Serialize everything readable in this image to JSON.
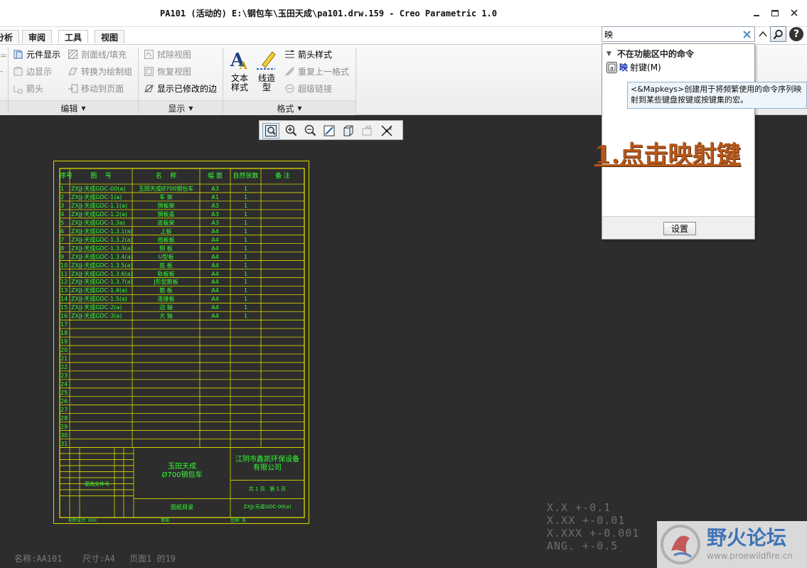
{
  "window": {
    "title": "PA101 (活动的) E:\\钢包车\\玉田天成\\pa101.drw.159 - Creo Parametric 1.0"
  },
  "tabs": [
    "分析",
    "审阅",
    "工具",
    "视图"
  ],
  "ribbon": {
    "edit_group": {
      "label": "编辑",
      "items": [
        {
          "label": "元件显示",
          "enabled": true
        },
        {
          "label": "边显示",
          "enabled": false
        },
        {
          "label": "箭头",
          "enabled": false
        },
        {
          "label": "剖面线/填充",
          "enabled": false
        },
        {
          "label": "转换为绘制组",
          "enabled": false
        },
        {
          "label": "移动到页面",
          "enabled": false
        }
      ]
    },
    "display_group": {
      "label": "显示",
      "items": [
        {
          "label": "拭除视图",
          "enabled": false
        },
        {
          "label": "恢复视图",
          "enabled": false
        },
        {
          "label": "显示已修改的边",
          "enabled": true
        }
      ]
    },
    "format_group": {
      "label": "格式",
      "text_style": "文本\n样式",
      "line_style": "线造\n型",
      "items": [
        {
          "label": "箭头样式",
          "enabled": true
        },
        {
          "label": "重复上一格式",
          "enabled": false
        },
        {
          "label": "超级链接",
          "enabled": false
        }
      ]
    }
  },
  "search": {
    "value": "映",
    "section_header": "不在功能区中的命令",
    "result_highlight": "映",
    "result_rest": "射键(M)",
    "settings_button": "设置",
    "tooltip": "<&Mapkeys>创建用于将频繁使用的命令序列映射到某些键盘按键或按键集的宏。"
  },
  "annotation": "1.点击映射键",
  "drawing": {
    "headers": [
      "序号",
      "图    号",
      "名    称",
      "幅 面",
      "自然张数",
      "备 注"
    ],
    "rows": [
      [
        "1",
        "ZXJJ-天成GDC-00(a)",
        "玉田天成Ø700钢包车",
        "A3",
        "1"
      ],
      [
        "2",
        "ZXJJ-天成GDC-1(a)",
        "车 架",
        "A1",
        "1"
      ],
      [
        "3",
        "ZXJJ-天成GDC-1.1(a)",
        "侧板架",
        "A3",
        "1"
      ],
      [
        "4",
        "ZXJJ-天成GDC-1.2(a)",
        "钢板盖",
        "A3",
        "1"
      ],
      [
        "5",
        "ZXJJ-天成GDC-1.3a)",
        "底板架",
        "A3",
        "1"
      ],
      [
        "6",
        "ZXJJ-天成GDC-1.3.1(a)",
        "上板",
        "A4",
        "1"
      ],
      [
        "7",
        "ZXJJ-天成GDC-1.3.2(a)",
        "挡板板",
        "A4",
        "1"
      ],
      [
        "8",
        "ZXJJ-天成GDC-1.3.3(a)",
        "侧 板",
        "A4",
        "1"
      ],
      [
        "9",
        "ZXJJ-天成GDC-1.3.4(a)",
        "U型板",
        "A4",
        "1"
      ],
      [
        "10",
        "ZXJJ-天成GDC-1.3.5(a)",
        "底 板",
        "A4",
        "1"
      ],
      [
        "11",
        "ZXJJ-天成GDC-1.3.6(a)",
        "轨板板",
        "A4",
        "1"
      ],
      [
        "12",
        "ZXJJ-天成GDC-1.3.7(a)",
        "J形型筋板",
        "A4",
        "1"
      ],
      [
        "13",
        "ZXJJ-天成GDC-1.4(a)",
        "筋 板",
        "A4",
        "1"
      ],
      [
        "14",
        "ZXJJ-天成GDC-1.5(a)",
        "连接板",
        "A4",
        "1"
      ],
      [
        "15",
        "ZXJJ-天成GDC-2(a)",
        "边 轴",
        "A4",
        "1"
      ],
      [
        "16",
        "ZXJJ-天成GDC-3(a)",
        "大 轴",
        "A4",
        "1"
      ]
    ],
    "extra_row_numbers": [
      "17",
      "18",
      "19",
      "20",
      "21",
      "22",
      "23",
      "24",
      "25",
      "26",
      "27",
      "28",
      "29",
      "30",
      "31"
    ],
    "project_name": "玉田天成\nØ700钢包车",
    "company": "江阴市鑫凯环保设备\n有限公司",
    "sheet_info": "共 1 页   第 1 页",
    "doc_title": "图纸目录",
    "doc_number": "ZXJJ-天成GDC-00(a)",
    "left_small": "更改文件号",
    "bottom_labels": [
      "初步设计: XXX",
      "审核:",
      "比例: 无"
    ]
  },
  "status": {
    "name": "名称:AA101",
    "size": "尺寸:A4",
    "page": "页面1 的19"
  },
  "tolerances": [
    "X.X   +-0.1",
    "X.XX  +-0.01",
    "X.XXX +-0.001",
    "ANG.  +-0.5"
  ],
  "watermark": {
    "name": "野火论坛",
    "url": "www.proewildfire.cn"
  },
  "colors": {
    "canvas": "#2d2d2d",
    "drawing_frame": "#d8d800",
    "drawing_text": "#33ff33",
    "annotation": "#b5581c",
    "search_border": "#9aa9bb"
  }
}
